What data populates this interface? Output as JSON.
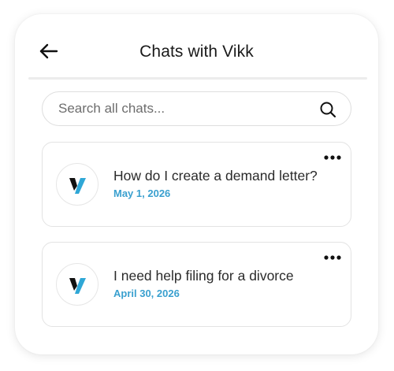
{
  "header": {
    "title": "Chats with Vikk",
    "back_icon": "arrow-left-icon"
  },
  "search": {
    "placeholder": "Search all chats...",
    "value": "",
    "icon": "search-icon"
  },
  "chats": [
    {
      "title": "How do I create a demand letter?",
      "date": "May 1, 2026",
      "avatar": "vikk-logo",
      "menu_icon": "more-horizontal-icon"
    },
    {
      "title": "I need help filing for a divorce",
      "date": "April 30, 2026",
      "avatar": "vikk-logo",
      "menu_icon": "more-horizontal-icon"
    }
  ],
  "colors": {
    "accent": "#3aa0cf",
    "logo_dark": "#111111",
    "logo_blue": "#2fa7d6"
  }
}
